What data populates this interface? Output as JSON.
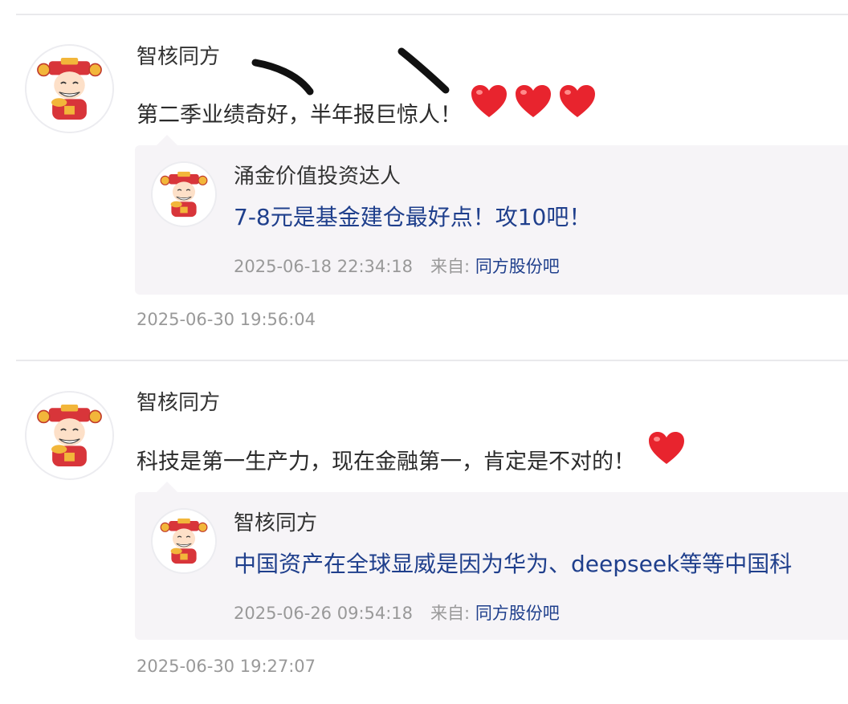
{
  "posts": [
    {
      "author": "智核同方",
      "content": "第二季业绩奇好，半年报巨惊人！",
      "hearts": 3,
      "quote": {
        "author": "涌金价值投资达人",
        "text": "7-8元是基金建仓最好点！攻10吧！",
        "time": "2025-06-18 22:34:18",
        "from_label": "来自:",
        "source": "同方股份吧"
      },
      "time": "2025-06-30 19:56:04"
    },
    {
      "author": "智核同方",
      "content": "科技是第一生产力，现在金融第一，肯定是不对的！",
      "hearts": 1,
      "quote": {
        "author": "智核同方",
        "text": "中国资产在全球显威是因为华为、deepseek等等中国科",
        "time": "2025-06-26 09:54:18",
        "from_label": "来自:",
        "source": "同方股份吧"
      },
      "time": "2025-06-30 19:27:07"
    }
  ],
  "colors": {
    "link": "#1f3f8c",
    "muted": "#999999",
    "quote_bg": "#f6f4f7",
    "heart": "#e8242e"
  },
  "icons": {
    "avatar": "caishen-avatar-icon",
    "emoji": "heart-emoji-icon"
  }
}
